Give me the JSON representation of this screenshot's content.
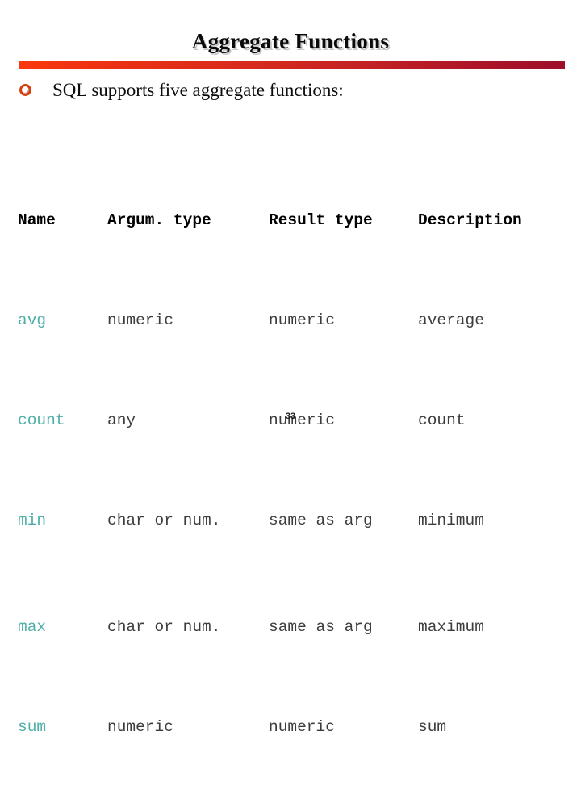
{
  "slide": {
    "title": "Aggregate Functions",
    "bullet_icon": "ring-bullet-icon",
    "bullet_text": "SQL supports five aggregate functions:",
    "page_number": "33",
    "accent_bar_start_color": "#F93A0E",
    "accent_bar_end_color": "#9D0F2A",
    "bullet_color": "#D4400F",
    "name_column_color": "#4FAFA8",
    "body_text_color": "#3C3C3C",
    "header_text_color": "#000000"
  },
  "table": {
    "headers": [
      "Name",
      "Argum. type",
      "Result type",
      "Description"
    ],
    "rows": [
      {
        "name": "avg",
        "argument_type": "numeric",
        "result_type": "numeric",
        "description": "average"
      },
      {
        "name": "count",
        "argument_type": "any",
        "result_type": "numeric",
        "description": "count"
      },
      {
        "name": "min",
        "argument_type": "char or num.",
        "result_type": "same as arg",
        "description": "minimum"
      },
      {
        "name": "max",
        "argument_type": "char or num.",
        "result_type": "same as arg",
        "description": "maximum"
      },
      {
        "name": "sum",
        "argument_type": "numeric",
        "result_type": "numeric",
        "description": "sum"
      }
    ]
  }
}
